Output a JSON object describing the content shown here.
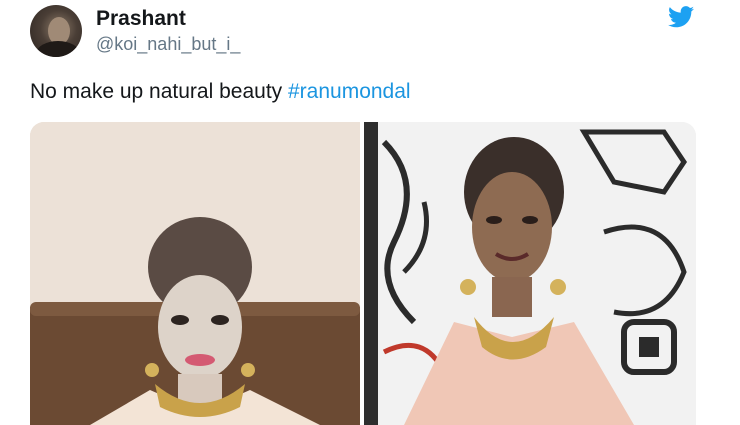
{
  "user": {
    "display_name": "Prashant",
    "handle": "@koi_nahi_but_i_"
  },
  "tweet": {
    "text": "No make up natural beauty ",
    "hashtag": "#ranumondal"
  },
  "icons": {
    "brand": "twitter-bird-icon",
    "brand_color": "#1da1f2",
    "hashtag_color": "#1b95e0"
  }
}
